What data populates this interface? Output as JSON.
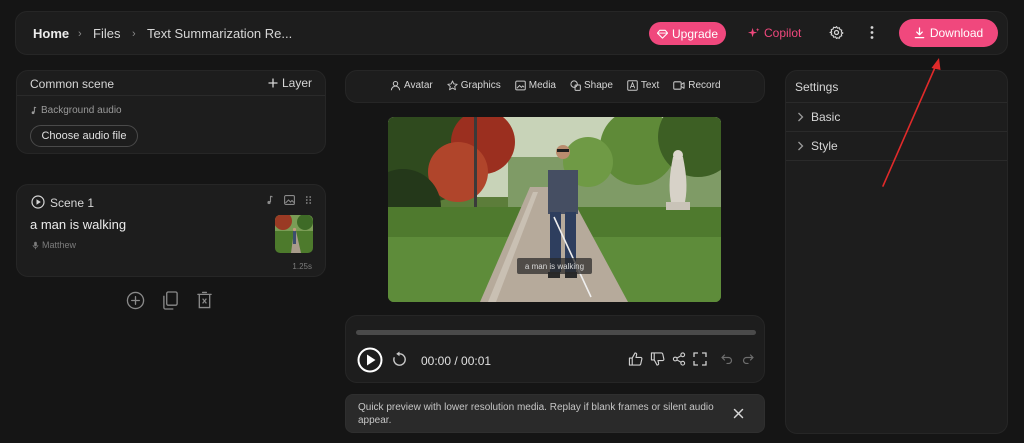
{
  "header": {
    "breadcrumb": [
      "Home",
      "Files",
      "Text Summarization Re..."
    ],
    "upgrade_label": "Upgrade",
    "copilot_label": "Copilot",
    "download_label": "Download"
  },
  "common_scene": {
    "title": "Common scene",
    "layer_label": "Layer",
    "background_audio_label": "Background audio",
    "choose_audio_label": "Choose audio file"
  },
  "scene": {
    "title": "Scene 1",
    "text": "a man is walking",
    "voice": "Matthew",
    "duration": "1.25s"
  },
  "toolbar": {
    "items": [
      {
        "label": "Avatar",
        "icon": "avatar-icon"
      },
      {
        "label": "Graphics",
        "icon": "graphics-icon"
      },
      {
        "label": "Media",
        "icon": "media-icon"
      },
      {
        "label": "Shape",
        "icon": "shape-icon"
      },
      {
        "label": "Text",
        "icon": "text-icon"
      },
      {
        "label": "Record",
        "icon": "record-icon"
      }
    ]
  },
  "preview": {
    "caption": "a man is walking"
  },
  "player": {
    "time": "00:00 / 00:01",
    "progress": 0
  },
  "notice": {
    "text": "Quick preview with lower resolution media. Replay if blank frames or silent audio appear."
  },
  "settings": {
    "title": "Settings",
    "sections": [
      "Basic",
      "Style"
    ]
  },
  "colors": {
    "accent": "#f0487d",
    "background": "#151515",
    "panel": "#1d1d1d",
    "annotation_arrow": "#e02a2a"
  }
}
